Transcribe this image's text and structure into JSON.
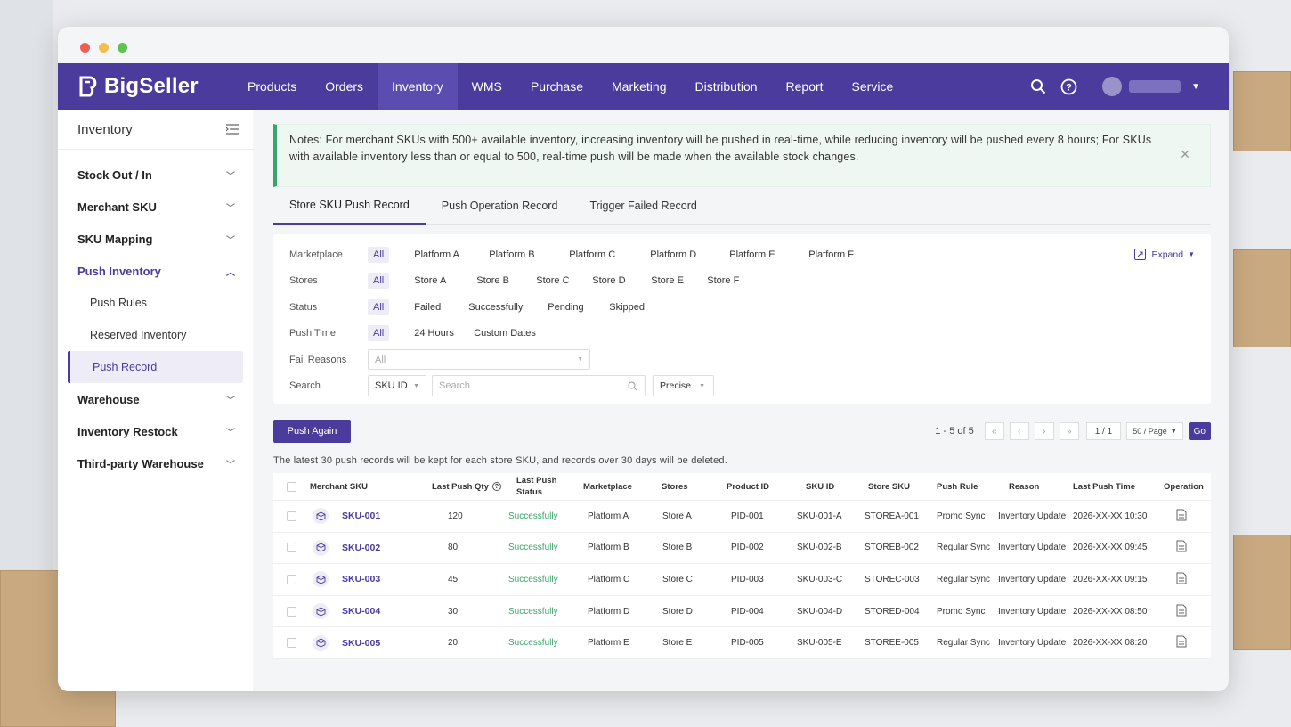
{
  "app": {
    "brand": "BigSeller"
  },
  "topnav": {
    "items": [
      "Products",
      "Orders",
      "Inventory",
      "WMS",
      "Purchase",
      "Marketing",
      "Distribution",
      "Report",
      "Service"
    ],
    "active": "Inventory"
  },
  "sidebar": {
    "title": "Inventory",
    "items": [
      {
        "label": "Stock Out / In"
      },
      {
        "label": "Merchant SKU"
      },
      {
        "label": "SKU Mapping"
      },
      {
        "label": "Push Inventory"
      },
      {
        "label": "Warehouse"
      },
      {
        "label": "Inventory Restock"
      },
      {
        "label": "Third-party Warehouse"
      }
    ],
    "sub": [
      "Push Rules",
      "Reserved Inventory",
      "Push Record"
    ],
    "selected_sub": "Push Record"
  },
  "notice": {
    "text": "Notes: For merchant SKUs with 500+ available inventory, increasing inventory will be pushed in real-time, while reducing inventory will be pushed every 8 hours; For SKUs with available inventory less than or equal to 500, real-time push will be made when the available stock changes."
  },
  "tabs": [
    "Store SKU Push Record",
    "Push Operation Record",
    "Trigger Failed Record"
  ],
  "filters": {
    "all": "All",
    "expand": "Expand",
    "marketplace": {
      "label": "Marketplace",
      "options": [
        "Platform A",
        "Platform B",
        "Platform C",
        "Platform D",
        "Platform E",
        "Platform F"
      ]
    },
    "stores": {
      "label": "Stores",
      "options": [
        "Store A",
        "Store B",
        "Store C",
        "Store D",
        "Store E",
        "Store F"
      ]
    },
    "status": {
      "label": "Status",
      "options": [
        "Failed",
        "Successfully",
        "Pending",
        "Skipped"
      ]
    },
    "push_time": {
      "label": "Push Time",
      "options": [
        "24 Hours",
        "Custom Dates"
      ]
    },
    "fail_reasons": {
      "label": "Fail Reasons",
      "value": "All"
    },
    "search": {
      "label": "Search",
      "field": "SKU ID",
      "placeholder": "Search",
      "mode": "Precise"
    }
  },
  "actions": {
    "push_again": "Push Again"
  },
  "pagination": {
    "summary": "1 - 5 of 5",
    "page": "1 / 1",
    "page_size": "50 / Page",
    "go": "Go"
  },
  "hint": "The latest 30 push records will be kept for each store SKU, and records over 30 days will be deleted.",
  "table": {
    "headers": [
      "Merchant SKU",
      "Last Push Qty",
      "Last Push Status",
      "Marketplace",
      "Stores",
      "Product ID",
      "SKU ID",
      "Store SKU",
      "Push Rule",
      "Reason",
      "Last Push Time",
      "Operation"
    ],
    "rows": [
      {
        "sku": "SKU-001",
        "qty": "120",
        "status": "Successfully",
        "market": "Platform A",
        "store": "Store A",
        "pid": "PID-001",
        "skuid": "SKU-001-A",
        "storesku": "STOREA-001",
        "rule": "Promo Sync",
        "reason": "Inventory Update",
        "time": "2026-XX-XX 10:30"
      },
      {
        "sku": "SKU-002",
        "qty": "80",
        "status": "Successfully",
        "market": "Platform B",
        "store": "Store B",
        "pid": "PID-002",
        "skuid": "SKU-002-B",
        "storesku": "STOREB-002",
        "rule": "Regular Sync",
        "reason": "Inventory Update",
        "time": "2026-XX-XX 09:45"
      },
      {
        "sku": "SKU-003",
        "qty": "45",
        "status": "Successfully",
        "market": "Platform C",
        "store": "Store C",
        "pid": "PID-003",
        "skuid": "SKU-003-C",
        "storesku": "STOREC-003",
        "rule": "Regular Sync",
        "reason": "Inventory Update",
        "time": "2026-XX-XX 09:15"
      },
      {
        "sku": "SKU-004",
        "qty": "30",
        "status": "Successfully",
        "market": "Platform D",
        "store": "Store D",
        "pid": "PID-004",
        "skuid": "SKU-004-D",
        "storesku": "STORED-004",
        "rule": "Promo Sync",
        "reason": "Inventory Update",
        "time": "2026-XX-XX 08:50"
      },
      {
        "sku": "SKU-005",
        "qty": "20",
        "status": "Successfully",
        "market": "Platform E",
        "store": "Store E",
        "pid": "PID-005",
        "skuid": "SKU-005-E",
        "storesku": "STOREE-005",
        "rule": "Regular Sync",
        "reason": "Inventory Update",
        "time": "2026-XX-XX 08:20"
      }
    ]
  },
  "colors": {
    "brand": "#4a3b9c",
    "success": "#3aa56a",
    "notice_bg": "#eef7f1"
  }
}
